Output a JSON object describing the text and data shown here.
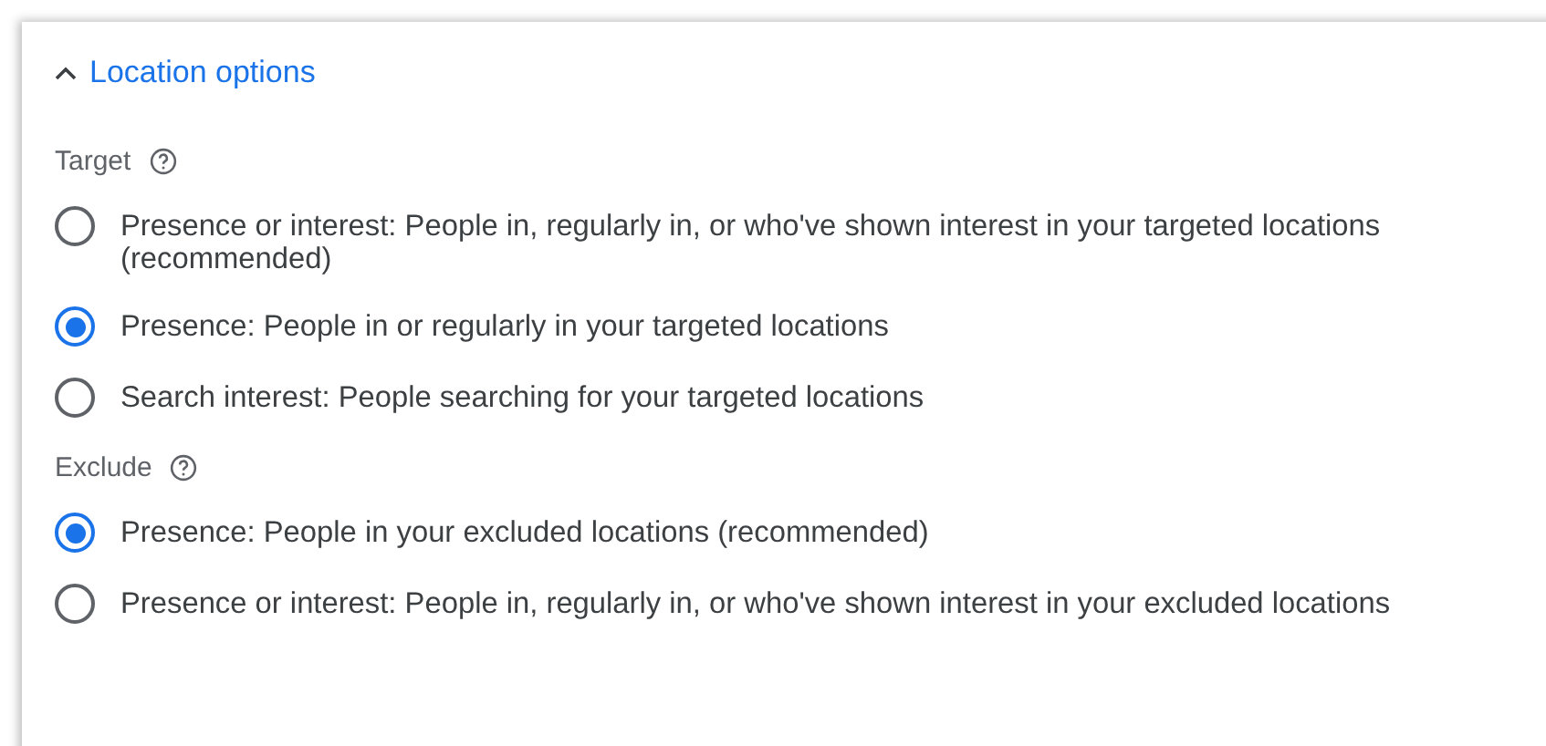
{
  "section": {
    "title": "Location options",
    "expanded": true
  },
  "groups": [
    {
      "label": "Target",
      "options": [
        {
          "label": "Presence or interest: People in, regularly in, or who've shown interest in your targeted locations (recommended)",
          "selected": false
        },
        {
          "label": "Presence: People in or regularly in your targeted locations",
          "selected": true
        },
        {
          "label": "Search interest: People searching for your targeted locations",
          "selected": false
        }
      ]
    },
    {
      "label": "Exclude",
      "options": [
        {
          "label": "Presence: People in your excluded locations (recommended)",
          "selected": true
        },
        {
          "label": "Presence or interest: People in, regularly in, or who've shown interest in your excluded locations",
          "selected": false
        }
      ]
    }
  ]
}
